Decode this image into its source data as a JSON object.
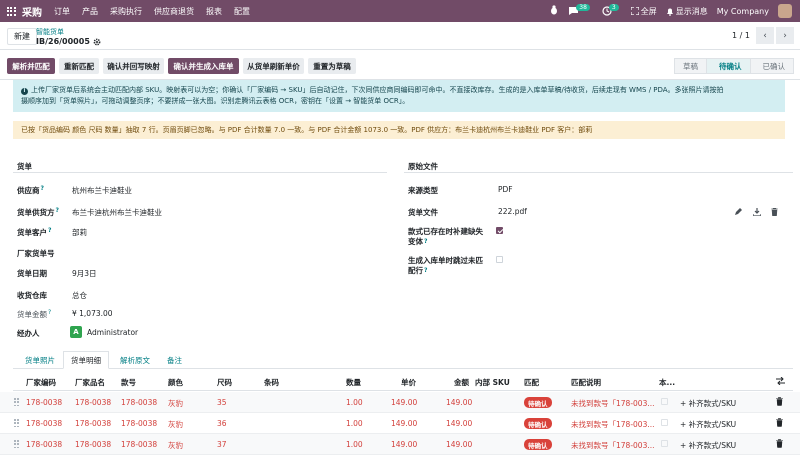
{
  "nav": {
    "brand": "采购",
    "menus": [
      "订单",
      "产品",
      "采购执行",
      "供应商退货",
      "报表",
      "配置"
    ],
    "chat_count": "38",
    "activity_count": "3",
    "fullscreen": "全屏",
    "show_messages": "显示消息",
    "company": "My Company"
  },
  "control": {
    "new_button": "新建",
    "breadcrumb_parent": "智能货单",
    "record_name": "IB/26/00005",
    "pager": "1 / 1"
  },
  "actions": {
    "buttons": [
      "解析并匹配",
      "重新匹配",
      "确认并回写映射",
      "确认并生成入库单",
      "从货单刷新单价",
      "重置为草稿"
    ],
    "status": [
      "草稿",
      "待确认",
      "已确认"
    ]
  },
  "alerts": {
    "info_line1": "上传厂家货单后系统会主动匹配内部 SKU。映射表可以为空；你确认「厂家编码 → SKU」后自动记住，下次同供应商同编码即可命中。不直接改库存。生成的是入库单草稿/待收货，后续走现有 WMS / PDA。多张照片请按拍",
    "info_line2": "摄顺序加到「货单照片」，可拖动调整页序；不要拼成一张大图。识别走腾讯云表格 OCR，密钥在「设置 → 智能货单 OCR」。",
    "warning": "已按「货品编码 颜色 尺码 数量」抽取 7 行。页眉页脚已忽略。与 PDF 合计数量 7.0 一致。与 PDF 合计金额 1073.0 一致。PDF 供应方：布兰卡迪杭州布兰卡迪鞋业 PDF 客户：部莉"
  },
  "form": {
    "left_section": "货单",
    "right_section": "原始文件",
    "fields": {
      "supplier_label": "供应商",
      "supplier": "杭州布兰卡迪鞋业",
      "bill_supplier_label": "货单供货方",
      "bill_supplier": "布兰卡迪杭州布兰卡迪鞋业",
      "bill_customer_label": "货单客户",
      "bill_customer": "部莉",
      "vendor_bill_no_label": "厂家货单号",
      "bill_date_label": "货单日期",
      "bill_date": "9月3日",
      "warehouse_label": "收货仓库",
      "warehouse": "总仓",
      "amount_label": "货单金额",
      "amount": "¥ 1,073.00",
      "handler_label": "经办人",
      "handler_avatar": "A",
      "handler": "Administrator",
      "source_type_label": "来源类型",
      "source_type": "PDF",
      "bill_file_label": "货单文件",
      "bill_file": "222.pdf",
      "variant_label_1": "款式已存在时补建缺失",
      "variant_label_2": "变体",
      "skip_label_1": "生成入库单时跳过未匹",
      "skip_label_2": "配行"
    }
  },
  "tabs": [
    "货单照片",
    "货单明细",
    "解析原文",
    "备注"
  ],
  "table": {
    "headers": [
      "厂家编码",
      "厂家品名",
      "款号",
      "颜色",
      "尺码",
      "条码",
      "数量",
      "单价",
      "金额",
      "内部 SKU",
      "匹配",
      "匹配说明",
      "本..."
    ],
    "rows": [
      {
        "code": "178-0038",
        "name": "178-0038",
        "style": "178-0038",
        "color": "灰豹",
        "size": "35",
        "qty": "1.00",
        "price": "149.00",
        "amount": "149.00",
        "status": "待确认",
        "note": "未找到款号「178-003...",
        "action": "补齐款式/SKU"
      },
      {
        "code": "178-0038",
        "name": "178-0038",
        "style": "178-0038",
        "color": "灰豹",
        "size": "36",
        "qty": "1.00",
        "price": "149.00",
        "amount": "149.00",
        "status": "待确认",
        "note": "未找到款号「178-003...",
        "action": "补齐款式/SKU"
      },
      {
        "code": "178-0038",
        "name": "178-0038",
        "style": "178-0038",
        "color": "灰豹",
        "size": "37",
        "qty": "1.00",
        "price": "149.00",
        "amount": "149.00",
        "status": "待确认",
        "note": "未找到款号「178-003...",
        "action": "补齐款式/SKU"
      }
    ]
  },
  "colors": {
    "brand": "#714b67",
    "accent": "#017e84",
    "danger": "#d9423a"
  }
}
